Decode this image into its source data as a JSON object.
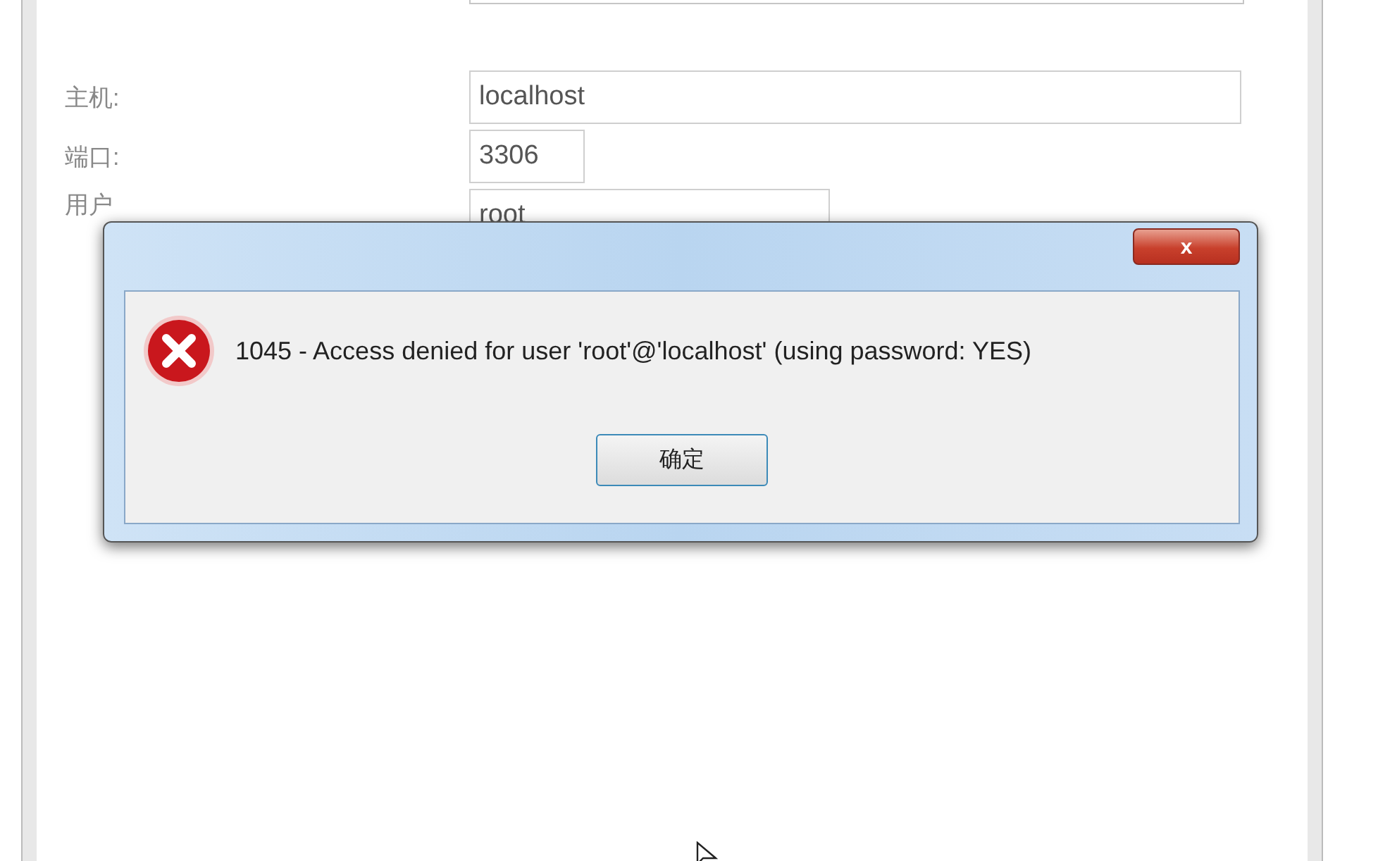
{
  "form": {
    "fields": [
      {
        "label": "主机:",
        "value": "localhost"
      },
      {
        "label": "端口:",
        "value": "3306"
      },
      {
        "label": "用户",
        "value": "root"
      }
    ]
  },
  "dialog": {
    "close": "x",
    "message": "1045 - Access denied for user 'root'@'localhost' (using password: YES)",
    "button": "确定"
  }
}
